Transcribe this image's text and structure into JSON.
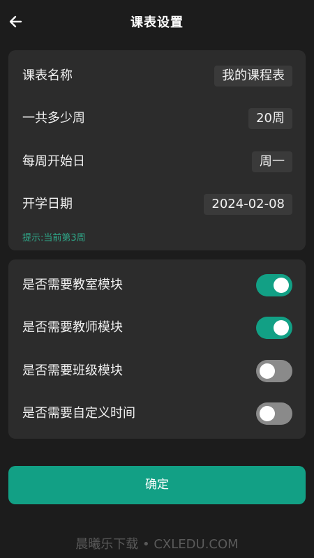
{
  "header": {
    "title": "课表设置",
    "back_icon": "arrow-left-icon"
  },
  "basic": {
    "items": [
      {
        "label": "课表名称",
        "value": "我的课程表"
      },
      {
        "label": "一共多少周",
        "value": "20周"
      },
      {
        "label": "每周开始日",
        "value": "周一"
      },
      {
        "label": "开学日期",
        "value": "2024-02-08"
      }
    ],
    "hint": "提示:当前第3周"
  },
  "modules": {
    "items": [
      {
        "label": "是否需要教室模块",
        "enabled": true
      },
      {
        "label": "是否需要教师模块",
        "enabled": true
      },
      {
        "label": "是否需要班级模块",
        "enabled": false
      },
      {
        "label": "是否需要自定义时间",
        "enabled": false
      }
    ]
  },
  "confirm_label": "确定",
  "watermark": "晨曦乐下载 • CXLEDU.COM",
  "colors": {
    "background": "#1c1c1c",
    "card": "#2c2c2c",
    "accent": "#12a085",
    "hint": "#2fa98a",
    "toggle_off": "#8a8a8a"
  }
}
